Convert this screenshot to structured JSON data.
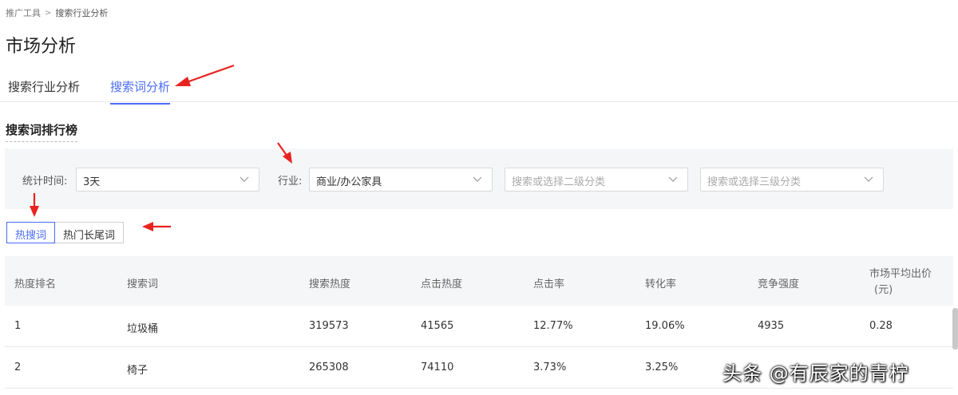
{
  "breadcrumb": {
    "root": "推广工具",
    "current": "搜索行业分析"
  },
  "page": {
    "title": "市场分析"
  },
  "tabs": [
    {
      "label": "搜索行业分析",
      "active": false
    },
    {
      "label": "搜索词分析",
      "active": true
    }
  ],
  "section": {
    "title": "搜索词排行榜"
  },
  "filters": {
    "time_label": "统计时间:",
    "time_value": "3天",
    "industry_label": "行业:",
    "industry_value": "商业/办公家具",
    "level2_placeholder": "搜索或选择二级分类",
    "level3_placeholder": "搜索或选择三级分类"
  },
  "segments": [
    {
      "label": "热搜词",
      "active": true
    },
    {
      "label": "热门长尾词",
      "active": false
    }
  ],
  "table": {
    "headers": [
      "热度排名",
      "搜索词",
      "搜索热度",
      "点击热度",
      "点击率",
      "转化率",
      "竞争强度",
      "市场平均出价",
      "(元)"
    ],
    "rows": [
      [
        "1",
        "垃圾桶",
        "319573",
        "41565",
        "12.77%",
        "19.06%",
        "4935",
        "0.28"
      ],
      [
        "2",
        "椅子",
        "265308",
        "74110",
        "3.73%",
        "3.25%",
        "",
        ""
      ]
    ]
  },
  "watermark": {
    "text": "头条 @有辰家的青柠"
  },
  "colors": {
    "accent": "#4a6cf7",
    "annotation_arrow": "#e8231f",
    "panel_bg": "#f5f6f8"
  },
  "icons": {
    "breadcrumb_separator": "chevron-right-icon",
    "select_caret": "chevron-down-icon"
  }
}
